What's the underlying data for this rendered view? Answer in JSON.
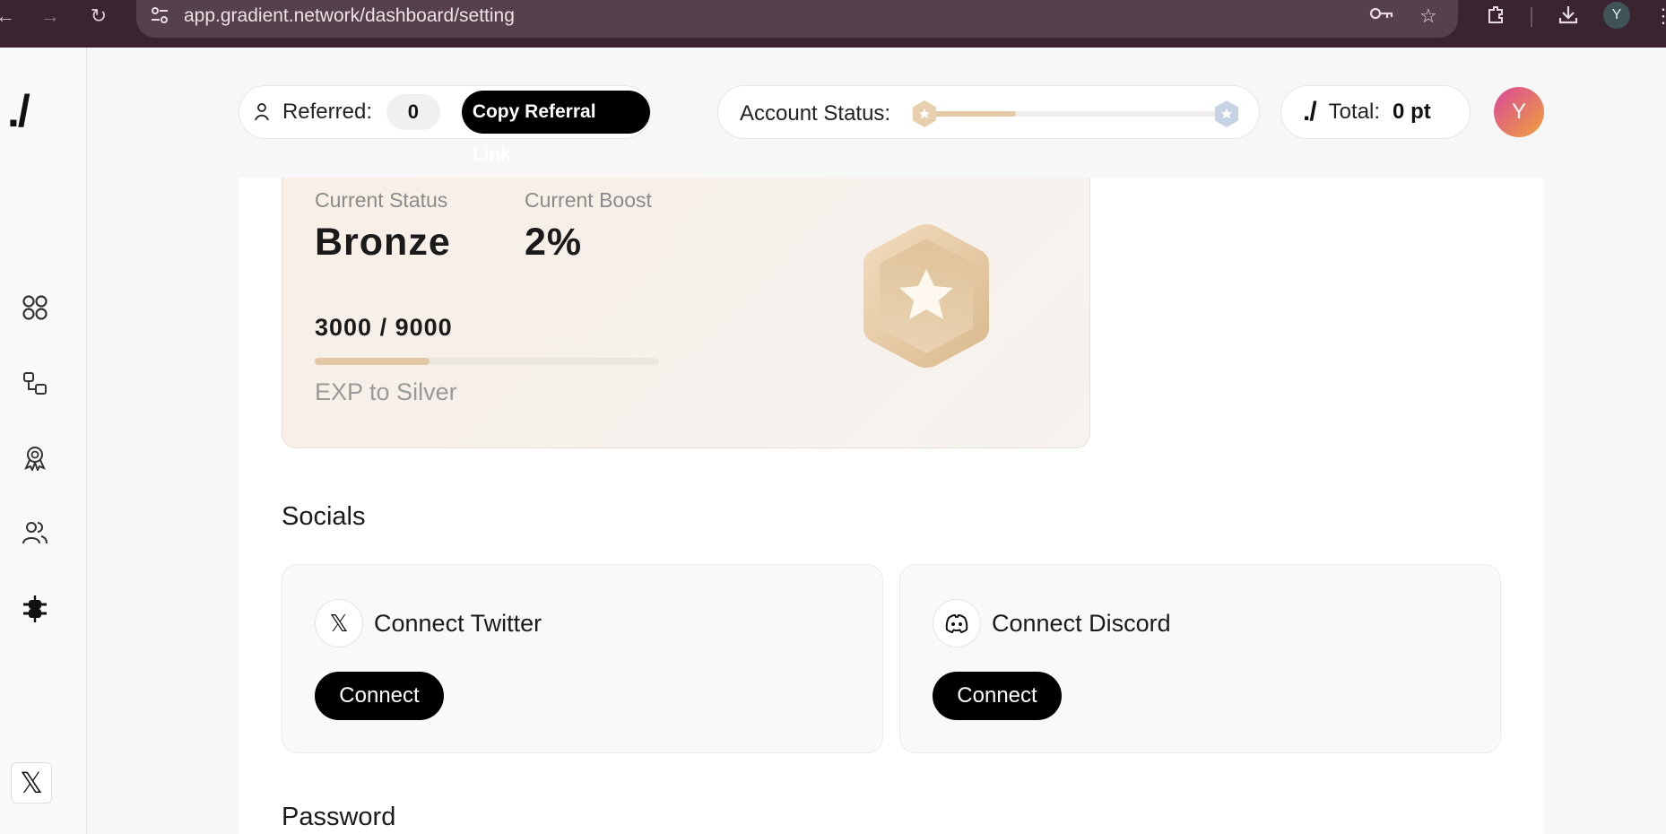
{
  "browser": {
    "url": "app.gradient.network/dashboard/setting",
    "profile_initial": "Y",
    "icons": [
      "back-icon",
      "forward-icon",
      "reload-icon",
      "site-info-icon",
      "key-icon",
      "star-icon",
      "extensions-icon",
      "download-icon",
      "menu-icon"
    ]
  },
  "sidebar": {
    "logo": "./",
    "items": [
      {
        "name": "dashboard",
        "icon": "grid-icon"
      },
      {
        "name": "nodes",
        "icon": "nodes-icon"
      },
      {
        "name": "rewards",
        "icon": "award-icon"
      },
      {
        "name": "referrals",
        "icon": "users-icon"
      },
      {
        "name": "settings",
        "icon": "sliders-icon",
        "active": true
      }
    ],
    "social_icon": "x-icon"
  },
  "header": {
    "referred_label": "Referred:",
    "referred_count": "0",
    "copy_button": "Copy Referral Link",
    "account_status_label": "Account Status:",
    "account_progress": 0.33,
    "total_logo": "./",
    "total_label": "Total:",
    "total_value": "0 pt",
    "avatar_initial": "Y"
  },
  "status_card": {
    "current_status_label": "Current Status",
    "current_status": "Bronze",
    "current_boost_label": "Current Boost",
    "current_boost": "2%",
    "exp_current": "3000",
    "exp_separator": "/",
    "exp_target": "9000",
    "exp_progress": 0.333,
    "exp_to_label": "EXP to Silver"
  },
  "socials": {
    "title": "Socials",
    "twitter": {
      "title": "Connect Twitter",
      "button": "Connect",
      "icon": "x-icon"
    },
    "discord": {
      "title": "Connect Discord",
      "button": "Connect",
      "icon": "discord-icon"
    }
  },
  "password": {
    "title": "Password"
  },
  "colors": {
    "accent": "#000000",
    "bronze": "#e2c8a4",
    "silver": "#c9d6e6",
    "chrome": "#3a2430"
  }
}
